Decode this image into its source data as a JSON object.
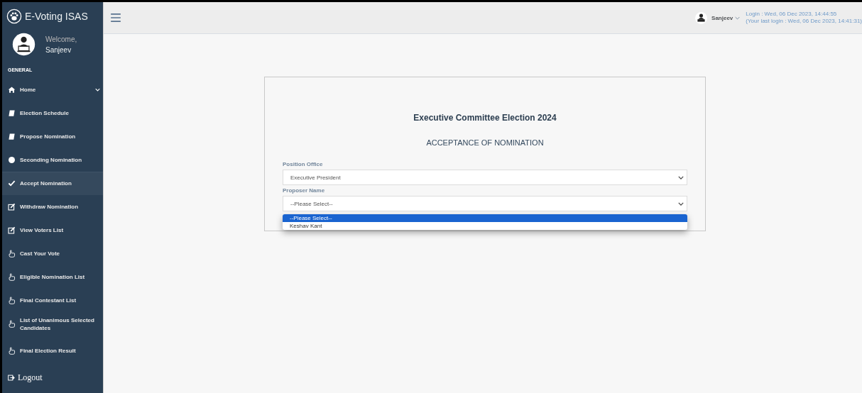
{
  "brand": {
    "title": "E-Voting ISAS"
  },
  "profile": {
    "greeting": "Welcome,",
    "name": "Sanjeev"
  },
  "sidebar": {
    "section": "GENERAL",
    "items": [
      {
        "label": "Home",
        "kind": "house",
        "selected": false,
        "caret": true
      },
      {
        "label": "Election Schedule",
        "kind": "book",
        "selected": false,
        "caret": false
      },
      {
        "label": "Propose Nomination",
        "kind": "book",
        "selected": false,
        "caret": false
      },
      {
        "label": "Seconding Nomination",
        "kind": "circle",
        "selected": false,
        "caret": false
      },
      {
        "label": "Accept Nomination",
        "kind": "check",
        "selected": true,
        "caret": false
      },
      {
        "label": "Withdraw Nomination",
        "kind": "edit",
        "selected": false,
        "caret": false
      },
      {
        "label": "View Voters List",
        "kind": "edit",
        "selected": false,
        "caret": false
      },
      {
        "label": "Cast Your Vote",
        "kind": "hand",
        "selected": false,
        "caret": false
      },
      {
        "label": "Eligible Nomination List",
        "kind": "hand",
        "selected": false,
        "caret": false
      },
      {
        "label": "Final Contestant List",
        "kind": "hand",
        "selected": false,
        "caret": false
      },
      {
        "label": "List of Unanimous Selected Candidates",
        "kind": "hand",
        "selected": false,
        "caret": false
      },
      {
        "label": "Final Election Result",
        "kind": "hand",
        "selected": false,
        "caret": false
      }
    ],
    "logout": "Logout"
  },
  "topbar": {
    "user": "Sanjeev",
    "login": "Login : Wed, 06 Dec 2023, 14:44:55",
    "last_login": "(Your last login : Wed, 06 Dec 2023, 14:41:31)"
  },
  "form": {
    "title": "Executive Committee Election 2024",
    "subtitle": "ACCEPTANCE OF NOMINATION",
    "fields": [
      {
        "label": "Position Office",
        "value": "Executive President"
      },
      {
        "label": "Proposer Name",
        "value": "--Please Select--"
      }
    ],
    "dropdown": [
      {
        "label": "--Please Select--",
        "selected": true
      },
      {
        "label": "Keshav Kant",
        "selected": false
      }
    ]
  }
}
